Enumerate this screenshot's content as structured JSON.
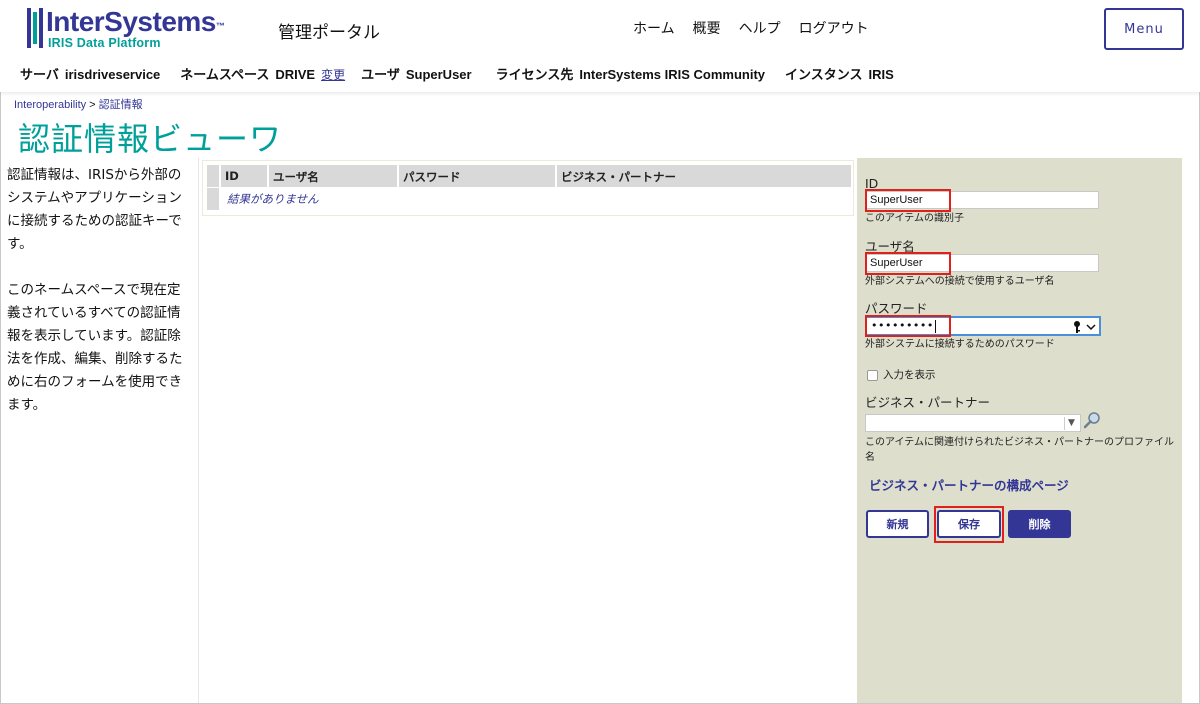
{
  "brand": {
    "name": "InterSystems",
    "trademark": "™",
    "sub": "IRIS Data Platform",
    "colors": {
      "primary": "#333695",
      "accent": "#00a09a",
      "highlight": "#e0201a",
      "panel": "#dedecd"
    }
  },
  "header": {
    "portal_title": "管理ポータル",
    "nav": [
      "ホーム",
      "概要",
      "ヘルプ",
      "ログアウト"
    ],
    "menu_label": "Menu"
  },
  "infobar": {
    "server_label": "サーバ",
    "server_value": "irisdriveservice",
    "namespace_label": "ネームスペース",
    "namespace_value": "DRIVE",
    "change_link": "変更",
    "user_label": "ユーザ",
    "user_value": "SuperUser",
    "license_label": "ライセンス先",
    "license_value": "InterSystems IRIS Community",
    "instance_label": "インスタンス",
    "instance_value": "IRIS"
  },
  "breadcrumb": {
    "root": "Interoperability",
    "sep": ">",
    "current": "認証情報"
  },
  "page_title": "認証情報ビューワ",
  "description": {
    "p1": "認証情報は、IRISから外部のシステムやアプリケーションに接続するための認証キーです。",
    "p2": "このネームスペースで現在定義されているすべての認証情報を表示しています。認証除法を作成、編集、削除するために右のフォームを使用できます。"
  },
  "table": {
    "columns": [
      "ID",
      "ユーザ名",
      "パスワード",
      "ビジネス・パートナー"
    ],
    "empty_message": "結果がありません"
  },
  "form": {
    "id_label": "ID",
    "id_value": "SuperUser",
    "id_hint": "このアイテムの識別子",
    "username_label": "ユーザ名",
    "username_value": "SuperUser",
    "username_hint": "外部システムへの接続で使用するユーザ名",
    "password_label": "パスワード",
    "password_value": "•••••••••",
    "password_hint": "外部システムに接続するためのパスワード",
    "show_input_label": "入力を表示",
    "partner_label": "ビジネス・パートナー",
    "partner_value": "",
    "partner_hint": "このアイテムに関連付けられたビジネス・パートナーのプロファイル名",
    "partner_link": "ビジネス・パートナーの構成ページ",
    "buttons": {
      "new": "新規",
      "save": "保存",
      "delete": "削除"
    }
  },
  "icons": {
    "key": "key-icon",
    "dropdown": "chevron-down-icon",
    "search": "search-icon"
  }
}
